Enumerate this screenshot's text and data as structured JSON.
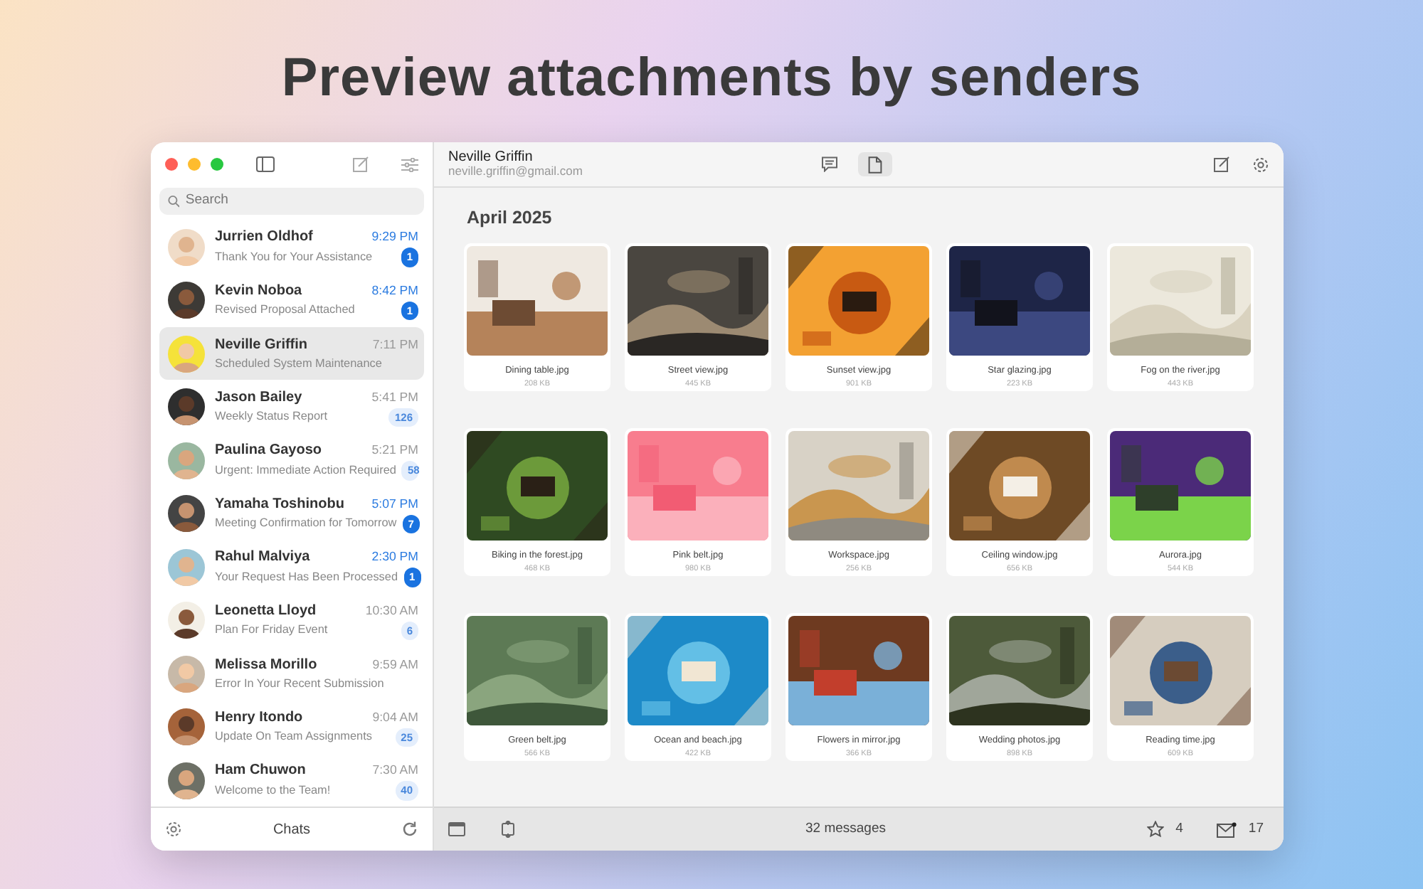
{
  "headline": "Preview attachments by senders",
  "sidebar": {
    "search": {
      "placeholder": "Search"
    },
    "chats": [
      {
        "name": "Jurrien Oldhof",
        "preview": "Thank You for Your Assistance",
        "time": "9:29 PM",
        "count": "1",
        "unread": true,
        "selected": false
      },
      {
        "name": "Kevin Noboa",
        "preview": "Revised Proposal Attached",
        "time": "8:42 PM",
        "count": "1",
        "unread": true,
        "selected": false
      },
      {
        "name": "Neville Griffin",
        "preview": "Scheduled System Maintenance",
        "time": "7:11 PM",
        "unread": false,
        "selected": true
      },
      {
        "name": "Jason Bailey",
        "preview": "Weekly Status Report",
        "time": "5:41 PM",
        "count": "126",
        "unread": false,
        "selected": false
      },
      {
        "name": "Paulina Gayoso",
        "preview": "Urgent: Immediate Action Required",
        "time": "5:21 PM",
        "count": "58",
        "unread": false,
        "selected": false
      },
      {
        "name": "Yamaha Toshinobu",
        "preview": "Meeting Confirmation for Tomorrow",
        "time": "5:07 PM",
        "count": "7",
        "unread": true,
        "selected": false
      },
      {
        "name": "Rahul Malviya",
        "preview": "Your Request Has Been Processed",
        "time": "2:30 PM",
        "count": "1",
        "unread": true,
        "selected": false
      },
      {
        "name": "Leonetta Lloyd",
        "preview": "Plan For Friday Event",
        "time": "10:30 AM",
        "count": "6",
        "unread": false,
        "selected": false
      },
      {
        "name": "Melissa Morillo",
        "preview": "Error In Your Recent Submission",
        "time": "9:59 AM",
        "unread": false,
        "selected": false
      },
      {
        "name": "Henry Itondo",
        "preview": "Update On Team Assignments",
        "time": "9:04 AM",
        "count": "25",
        "unread": false,
        "selected": false
      },
      {
        "name": "Ham Chuwon",
        "preview": "Welcome to the Team!",
        "time": "7:30 AM",
        "count": "40",
        "unread": false,
        "selected": false
      }
    ],
    "footer_title": "Chats"
  },
  "header": {
    "name": "Neville Griffin",
    "email": "neville.griffin@gmail.com",
    "views": [
      {
        "kind": "chat",
        "selected": false
      },
      {
        "kind": "files",
        "selected": true
      }
    ]
  },
  "section_title": "April 2025",
  "attachments": [
    {
      "filename": "Dining table.jpg",
      "size": "208 KB"
    },
    {
      "filename": "Street view.jpg",
      "size": "445 KB"
    },
    {
      "filename": "Sunset view.jpg",
      "size": "901 KB"
    },
    {
      "filename": "Star glazing.jpg",
      "size": "223 KB"
    },
    {
      "filename": "Fog on the river.jpg",
      "size": "443 KB"
    },
    {
      "filename": "Biking in the forest.jpg",
      "size": "468 KB"
    },
    {
      "filename": "Pink belt.jpg",
      "size": "980 KB"
    },
    {
      "filename": "Workspace.jpg",
      "size": "256 KB"
    },
    {
      "filename": "Ceiling window.jpg",
      "size": "656 KB"
    },
    {
      "filename": "Aurora.jpg",
      "size": "544 KB"
    },
    {
      "filename": "Green belt.jpg",
      "size": "566 KB"
    },
    {
      "filename": "Ocean and beach.jpg",
      "size": "422 KB"
    },
    {
      "filename": "Flowers in mirror.jpg",
      "size": "366 KB"
    },
    {
      "filename": "Wedding photos.jpg",
      "size": "898 KB"
    },
    {
      "filename": "Reading time.jpg",
      "size": "609 KB"
    }
  ],
  "status_bar": {
    "message_count": "32 messages",
    "starred": "4",
    "mail": "17"
  }
}
